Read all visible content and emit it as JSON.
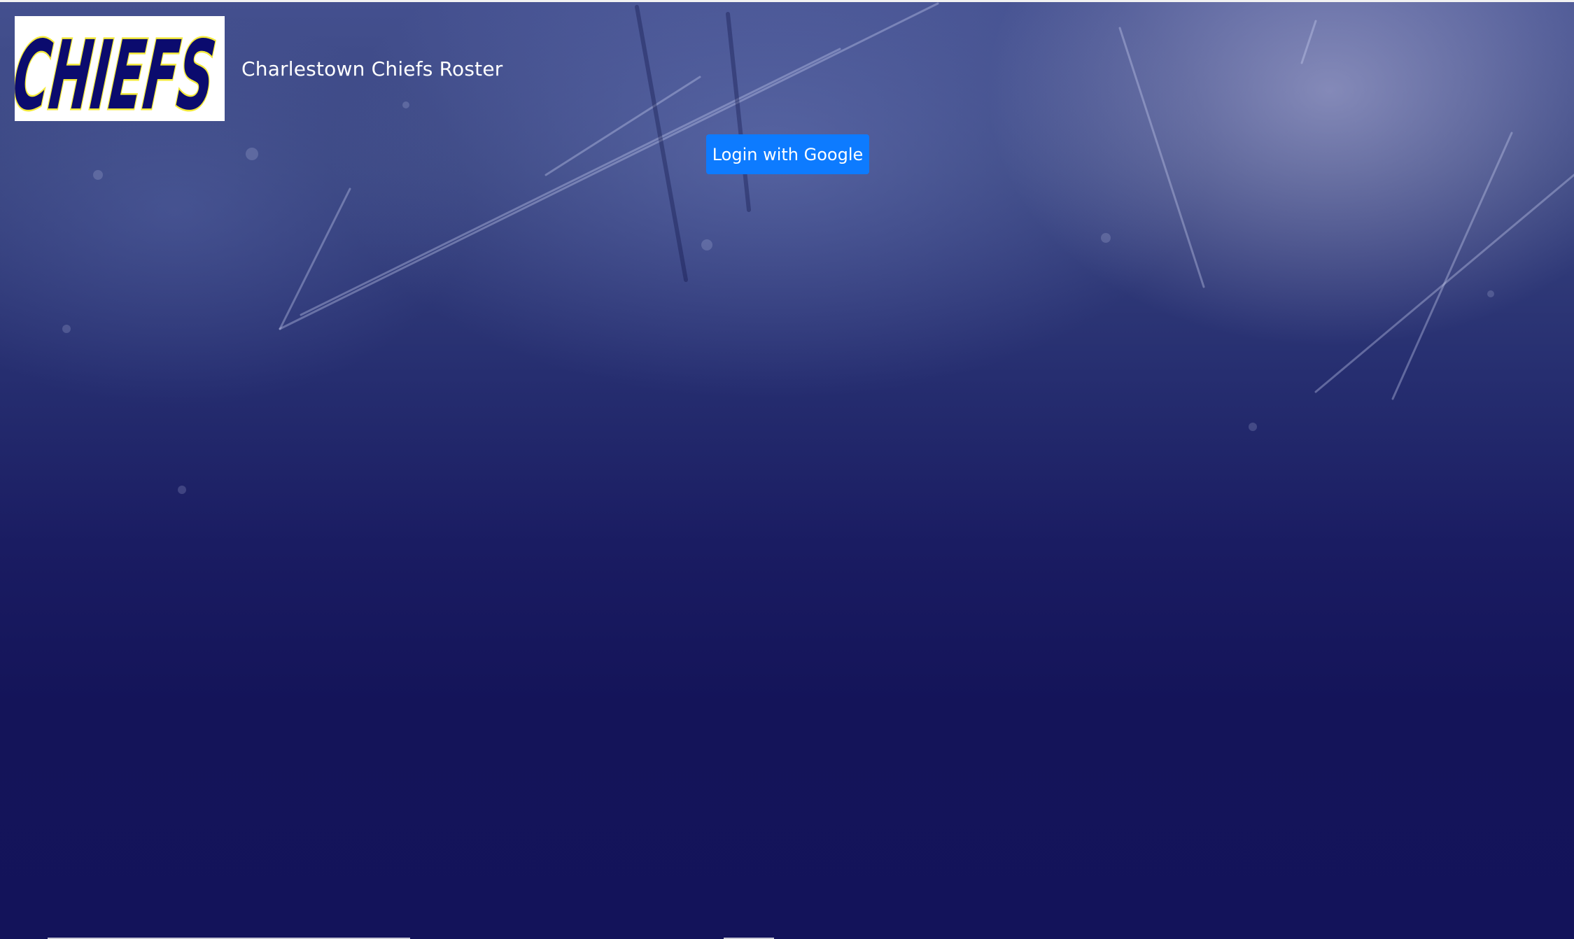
{
  "header": {
    "logo_text": "CHIEFS",
    "title": "Charlestown Chiefs Roster"
  },
  "auth": {
    "login_label": "Login with Google"
  },
  "colors": {
    "background_dark": "#13135a",
    "background_light": "#44508f",
    "button": "#0d7bff",
    "logo_letters": "#0b0b6e",
    "logo_outline": "#f3ea3a",
    "text": "#ffffff"
  }
}
